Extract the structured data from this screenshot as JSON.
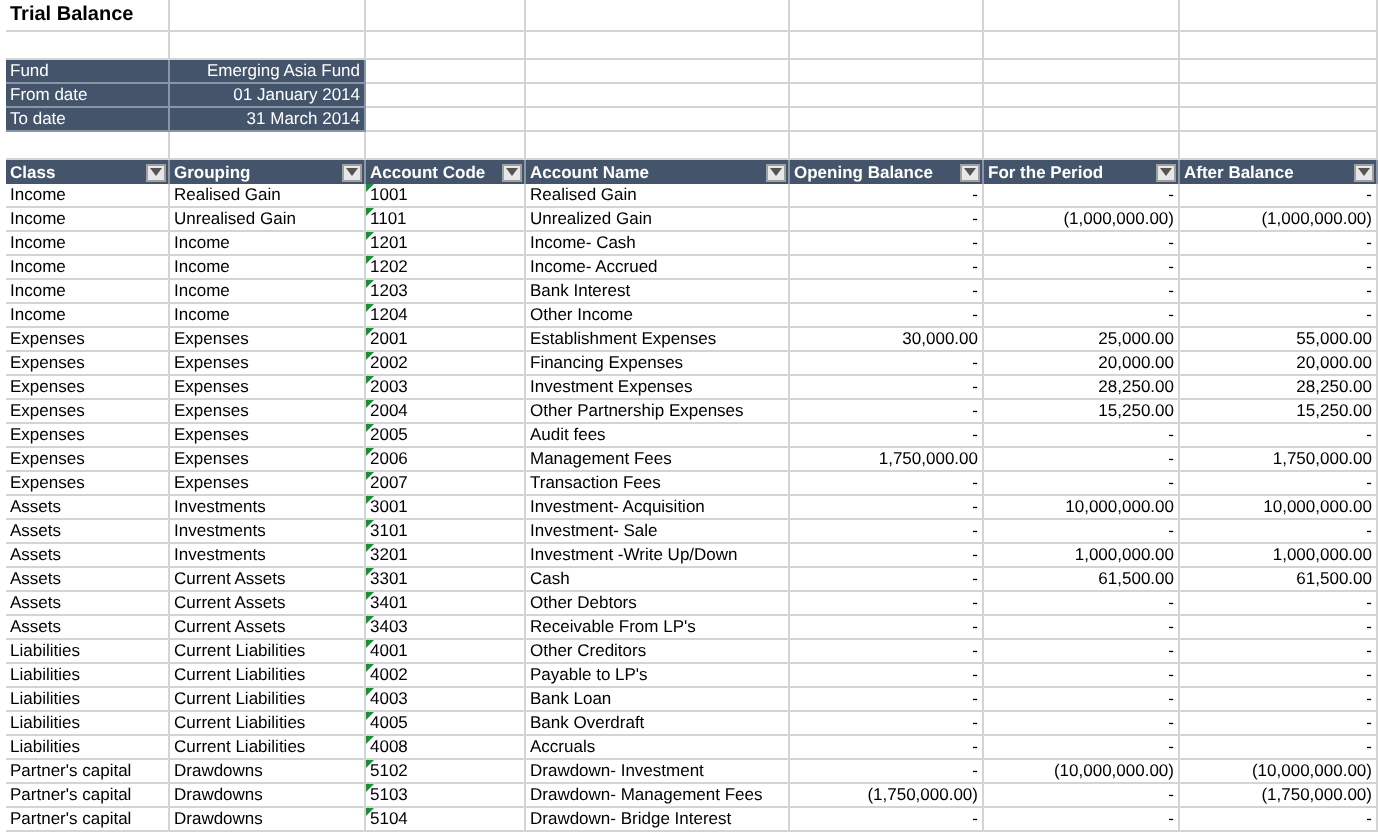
{
  "title": "Trial Balance",
  "fund_info": [
    {
      "label": "Fund",
      "value": "Emerging Asia Fund"
    },
    {
      "label": "From date",
      "value": "01 January 2014"
    },
    {
      "label": "To date",
      "value": "31 March 2014"
    }
  ],
  "table": {
    "columns": [
      "Class",
      "Grouping",
      "Account Code",
      "Account Name",
      "Opening Balance",
      "For the Period",
      "After Balance"
    ],
    "rows": [
      [
        "Income",
        "Realised Gain",
        "1001",
        "Realised Gain",
        "-",
        "-",
        "-"
      ],
      [
        "Income",
        "Unrealised Gain",
        "1101",
        "Unrealized Gain",
        "-",
        "(1,000,000.00)",
        "(1,000,000.00)"
      ],
      [
        "Income",
        "Income",
        "1201",
        "Income- Cash",
        "-",
        "-",
        "-"
      ],
      [
        "Income",
        "Income",
        "1202",
        "Income- Accrued",
        "-",
        "-",
        "-"
      ],
      [
        "Income",
        "Income",
        "1203",
        "Bank Interest",
        "-",
        "-",
        "-"
      ],
      [
        "Income",
        "Income",
        "1204",
        "Other Income",
        "-",
        "-",
        "-"
      ],
      [
        "Expenses",
        "Expenses",
        "2001",
        "Establishment Expenses",
        "30,000.00",
        "25,000.00",
        "55,000.00"
      ],
      [
        "Expenses",
        "Expenses",
        "2002",
        "Financing Expenses",
        "-",
        "20,000.00",
        "20,000.00"
      ],
      [
        "Expenses",
        "Expenses",
        "2003",
        "Investment Expenses",
        "-",
        "28,250.00",
        "28,250.00"
      ],
      [
        "Expenses",
        "Expenses",
        "2004",
        "Other Partnership Expenses",
        "-",
        "15,250.00",
        "15,250.00"
      ],
      [
        "Expenses",
        "Expenses",
        "2005",
        "Audit fees",
        "-",
        "-",
        "-"
      ],
      [
        "Expenses",
        "Expenses",
        "2006",
        "Management Fees",
        "1,750,000.00",
        "-",
        "1,750,000.00"
      ],
      [
        "Expenses",
        "Expenses",
        "2007",
        "Transaction Fees",
        "-",
        "-",
        "-"
      ],
      [
        "Assets",
        "Investments",
        "3001",
        "Investment- Acquisition",
        "-",
        "10,000,000.00",
        "10,000,000.00"
      ],
      [
        "Assets",
        "Investments",
        "3101",
        "Investment- Sale",
        "-",
        "-",
        "-"
      ],
      [
        "Assets",
        "Investments",
        "3201",
        "Investment -Write Up/Down",
        "-",
        "1,000,000.00",
        "1,000,000.00"
      ],
      [
        "Assets",
        "Current Assets",
        "3301",
        "Cash",
        "-",
        "61,500.00",
        "61,500.00"
      ],
      [
        "Assets",
        "Current Assets",
        "3401",
        "Other Debtors",
        "-",
        "-",
        "-"
      ],
      [
        "Assets",
        "Current Assets",
        "3403",
        "Receivable From LP's",
        "-",
        "-",
        "-"
      ],
      [
        "Liabilities",
        "Current Liabilities",
        "4001",
        "Other Creditors",
        "-",
        "-",
        "-"
      ],
      [
        "Liabilities",
        "Current Liabilities",
        "4002",
        "Payable to LP's",
        "-",
        "-",
        "-"
      ],
      [
        "Liabilities",
        "Current Liabilities",
        "4003",
        "Bank Loan",
        "-",
        "-",
        "-"
      ],
      [
        "Liabilities",
        "Current Liabilities",
        "4005",
        "Bank Overdraft",
        "-",
        "-",
        "-"
      ],
      [
        "Liabilities",
        "Current Liabilities",
        "4008",
        "Accruals",
        "-",
        "-",
        "-"
      ],
      [
        "Partner's capital",
        "Drawdowns",
        "5102",
        "Drawdown- Investment",
        "-",
        "(10,000,000.00)",
        "(10,000,000.00)"
      ],
      [
        "Partner's capital",
        "Drawdowns",
        "5103",
        "Drawdown- Management Fees",
        "(1,750,000.00)",
        "-",
        "(1,750,000.00)"
      ],
      [
        "Partner's capital",
        "Drawdowns",
        "5104",
        "Drawdown- Bridge Interest",
        "-",
        "-",
        "-"
      ]
    ]
  }
}
